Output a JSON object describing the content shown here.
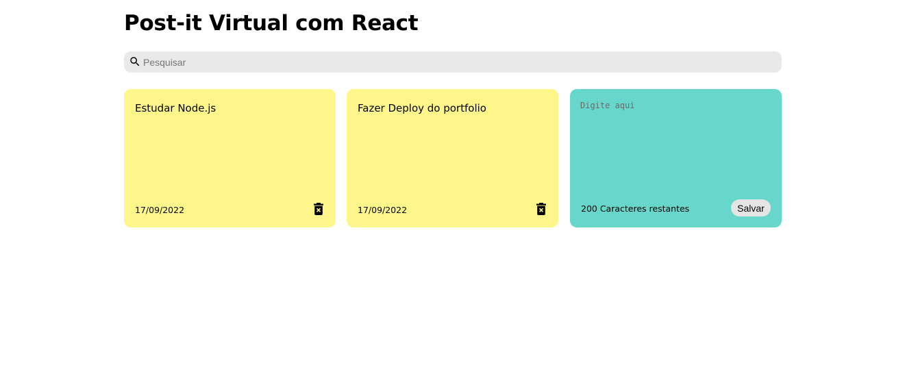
{
  "header": {
    "title": "Post-it Virtual com React"
  },
  "search": {
    "icon": "search-icon",
    "placeholder": "Pesquisar",
    "value": ""
  },
  "notes": [
    {
      "text": "Estudar Node.js",
      "date": "17/09/2022",
      "color": "#fef68a",
      "delete_icon": "trash-x-icon"
    },
    {
      "text": "Fazer Deploy do portfolio",
      "date": "17/09/2022",
      "color": "#fef68a",
      "delete_icon": "trash-x-icon"
    }
  ],
  "new_note": {
    "placeholder": "Digite aqui",
    "value": "",
    "chars_remaining_label": "200 Caracteres restantes",
    "save_label": "Salvar",
    "color": "#67d7cc"
  },
  "colors": {
    "search_bg": "#e9e9e9",
    "note_yellow": "#fef68a",
    "note_new": "#67d7cc",
    "button_bg": "#e5e5e5"
  }
}
